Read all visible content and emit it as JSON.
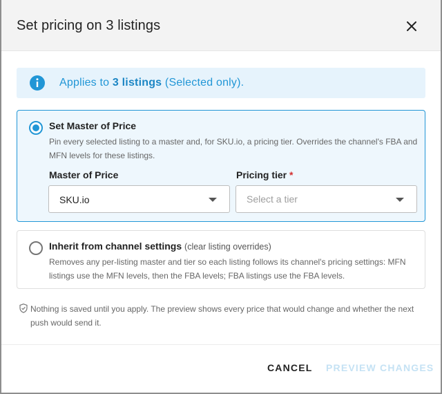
{
  "dialog": {
    "title": "Set pricing on 3 listings"
  },
  "info": {
    "prefix": "Applies to ",
    "count_text": "3 listings",
    "suffix": " (Selected only)."
  },
  "options": {
    "master": {
      "title": "Set Master of Price",
      "description": "Pin every selected listing to a master and, for SKU.io, a pricing tier. Overrides the channel's FBA and MFN levels for these listings.",
      "selected": true,
      "master_label": "Master of Price",
      "master_value": "SKU.io",
      "tier_label": "Pricing tier",
      "tier_required_mark": "*",
      "tier_placeholder": "Select a tier"
    },
    "inherit": {
      "title": "Inherit from channel settings",
      "subtitle": "(clear listing overrides)",
      "description": "Removes any per-listing master and tier so each listing follows its channel's pricing settings: MFN listings use the MFN levels, then the FBA levels; FBA listings use the FBA levels.",
      "selected": false
    }
  },
  "footnote": "Nothing is saved until you apply. The preview shows every price that would change and whether the next push would send it.",
  "footer": {
    "cancel_label": "CANCEL",
    "preview_label": "PREVIEW CHANGES"
  },
  "icons": {
    "close": "close-icon",
    "info": "info-icon",
    "caret": "chevron-down-icon",
    "shield": "shield-check-icon"
  },
  "colors": {
    "accent": "#2196d6",
    "banner_bg": "#e6f3fc",
    "selected_card_bg": "#eef7fd",
    "required": "#d32f2f",
    "disabled_button": "#c5e2f4"
  }
}
